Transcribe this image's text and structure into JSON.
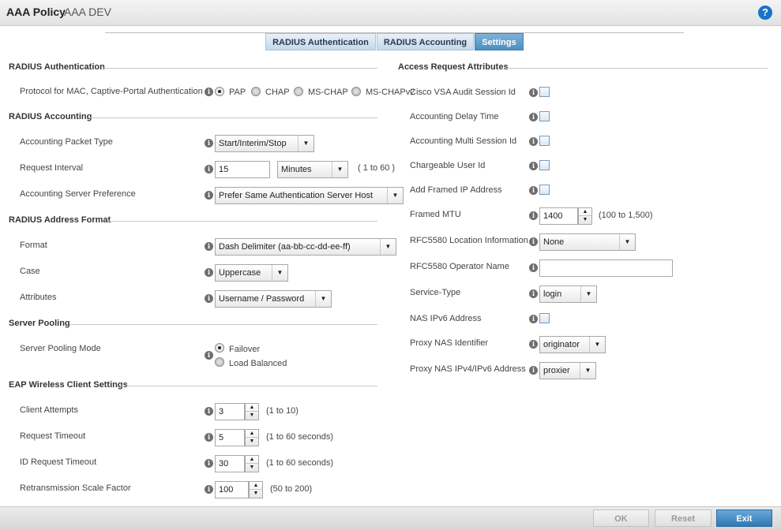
{
  "header": {
    "title": "AAA Policy",
    "subtitle": "AAA DEV",
    "help_icon": "?"
  },
  "tabs": [
    {
      "label": "RADIUS Authentication"
    },
    {
      "label": "RADIUS Accounting"
    },
    {
      "label": "Settings",
      "active": true
    }
  ],
  "radius_auth": {
    "title": "RADIUS Authentication",
    "protocol_label": "Protocol for MAC, Captive-Portal Authentication",
    "options": [
      "PAP",
      "CHAP",
      "MS-CHAP",
      "MS-CHAPv2"
    ],
    "selected": "PAP"
  },
  "radius_acct": {
    "title": "RADIUS Accounting",
    "packet_type_label": "Accounting Packet Type",
    "packet_type_value": "Start/Interim/Stop",
    "interval_label": "Request Interval",
    "interval_value": "15",
    "interval_unit": "Minutes",
    "interval_hint": "( 1 to 60 )",
    "server_pref_label": "Accounting Server Preference",
    "server_pref_value": "Prefer Same Authentication Server Host"
  },
  "address_format": {
    "title": "RADIUS Address Format",
    "format_label": "Format",
    "format_value": "Dash Delimiter (aa-bb-cc-dd-ee-ff)",
    "case_label": "Case",
    "case_value": "Uppercase",
    "attributes_label": "Attributes",
    "attributes_value": "Username / Password"
  },
  "server_pooling": {
    "title": "Server Pooling",
    "mode_label": "Server Pooling Mode",
    "options": [
      "Failover",
      "Load Balanced"
    ],
    "selected": "Failover"
  },
  "eap": {
    "title": "EAP Wireless Client Settings",
    "client_attempts_label": "Client Attempts",
    "client_attempts_value": "3",
    "client_attempts_hint": "(1 to 10)",
    "request_timeout_label": "Request Timeout",
    "request_timeout_value": "5",
    "request_timeout_hint": "(1 to 60 seconds)",
    "id_request_timeout_label": "ID Request Timeout",
    "id_request_timeout_value": "30",
    "id_request_timeout_hint": "(1 to 60 seconds)",
    "retrans_label": "Retransmission Scale Factor",
    "retrans_value": "100",
    "retrans_hint": "(50 to 200)"
  },
  "access_request": {
    "title": "Access Request Attributes",
    "cisco_vsa_label": "Cisco VSA Audit Session Id",
    "delay_time_label": "Accounting Delay Time",
    "multi_session_label": "Accounting Multi Session Id",
    "chargeable_label": "Chargeable User Id",
    "framed_ip_label": "Add Framed IP Address",
    "framed_mtu_label": "Framed MTU",
    "framed_mtu_value": "1400",
    "framed_mtu_hint": "(100 to 1,500)",
    "location_label": "RFC5580 Location Information",
    "location_value": "None",
    "operator_label": "RFC5580 Operator Name",
    "operator_value": "",
    "service_type_label": "Service-Type",
    "service_type_value": "login",
    "nas_ipv6_label": "NAS IPv6 Address",
    "proxy_nas_id_label": "Proxy NAS Identifier",
    "proxy_nas_id_value": "originator",
    "proxy_nas_ip_label": "Proxy NAS IPv4/IPv6 Address",
    "proxy_nas_ip_value": "proxier"
  },
  "footer": {
    "ok": "OK",
    "reset": "Reset",
    "exit": "Exit"
  }
}
